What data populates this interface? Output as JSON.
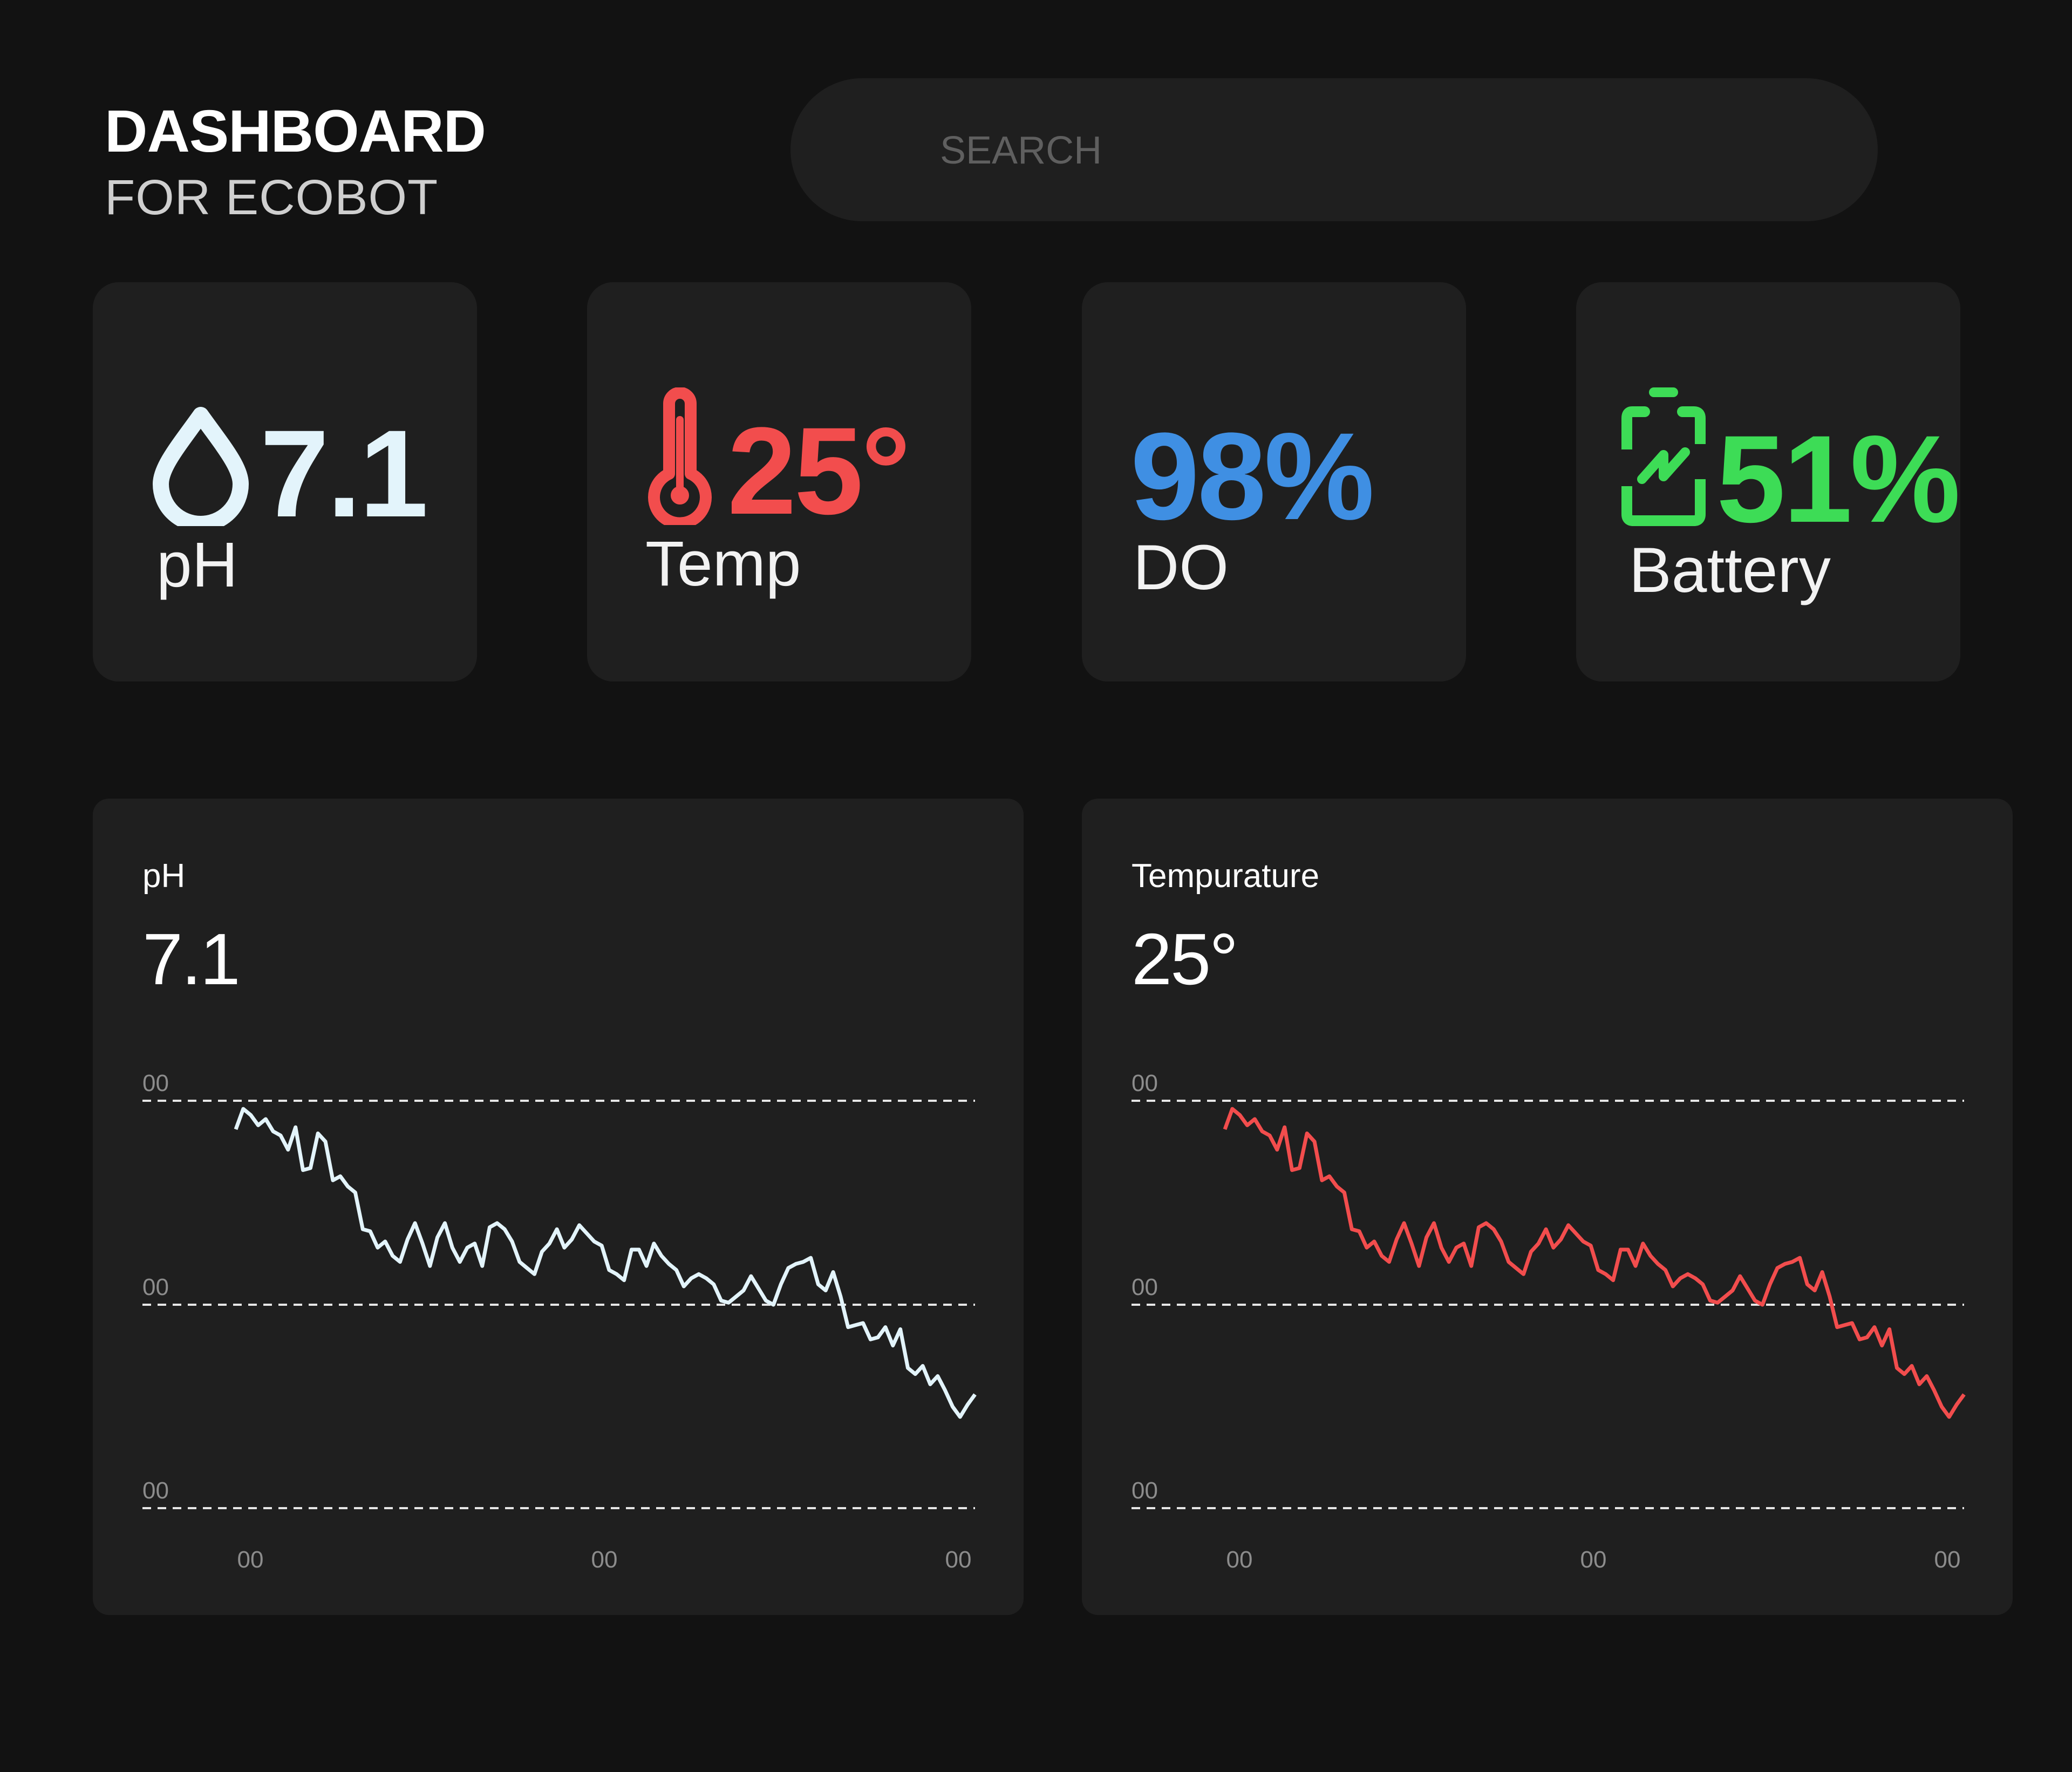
{
  "header": {
    "title": "DASHBOARD",
    "subtitle": "FOR ECOBOT"
  },
  "search": {
    "placeholder": "SEARCH",
    "value": ""
  },
  "cards": [
    {
      "icon": "water-drop-icon",
      "value": "7.1",
      "label": "pH",
      "color": "#e3f4fb"
    },
    {
      "icon": "thermometer-icon",
      "value": "25°",
      "label": "Temp",
      "color": "#f24d4d"
    },
    {
      "icon": "",
      "value": "98%",
      "label": "DO",
      "color": "#3f8fe3"
    },
    {
      "icon": "battery-charging-icon",
      "value": "51%",
      "label": "Battery",
      "color": "#3ddc56"
    }
  ],
  "panels": [
    {
      "title": "pH",
      "value": "7.1"
    },
    {
      "title": "Tempurature",
      "value": "25°"
    }
  ],
  "chart_data": [
    {
      "type": "line",
      "title": "pH",
      "color": "#e3f4fb",
      "y_tick_labels": [
        "00",
        "00",
        "00"
      ],
      "x_tick_labels": [
        "00",
        "00",
        "00"
      ],
      "grid": "dashed horizontal",
      "ylim": [
        0,
        100
      ],
      "series": [
        {
          "values": [
            86,
            96,
            93,
            88,
            91,
            85,
            83,
            76,
            87,
            66,
            67,
            84,
            80,
            61,
            63,
            58,
            55,
            37,
            36,
            28,
            31,
            24,
            21,
            32,
            40,
            30,
            19,
            33,
            40,
            28,
            21,
            28,
            30,
            19,
            38,
            40,
            37,
            31,
            21,
            18,
            15,
            26,
            30,
            37,
            28,
            32,
            39,
            35,
            31,
            29,
            17,
            15,
            12,
            27,
            27,
            19,
            30,
            24,
            20,
            17,
            9,
            13,
            15,
            13,
            10,
            2,
            1,
            4,
            7,
            14,
            8,
            2,
            0,
            10,
            18,
            20,
            21,
            23,
            10,
            7,
            16,
            4,
            -11,
            -10,
            -9,
            -17,
            -16,
            -11,
            -20,
            -12,
            -31,
            -34,
            -30,
            -39,
            -35,
            -42,
            -50,
            -55,
            -49,
            -44
          ]
        }
      ]
    },
    {
      "type": "line",
      "title": "Tempurature",
      "color": "#f24d4d",
      "y_tick_labels": [
        "00",
        "00",
        "00"
      ],
      "x_tick_labels": [
        "00",
        "00",
        "00"
      ],
      "grid": "dashed horizontal",
      "ylim": [
        0,
        100
      ],
      "series": [
        {
          "values": [
            86,
            96,
            93,
            88,
            91,
            85,
            83,
            76,
            87,
            66,
            67,
            84,
            80,
            61,
            63,
            58,
            55,
            37,
            36,
            28,
            31,
            24,
            21,
            32,
            40,
            30,
            19,
            33,
            40,
            28,
            21,
            28,
            30,
            19,
            38,
            40,
            37,
            31,
            21,
            18,
            15,
            26,
            30,
            37,
            28,
            32,
            39,
            35,
            31,
            29,
            17,
            15,
            12,
            27,
            27,
            19,
            30,
            24,
            20,
            17,
            9,
            13,
            15,
            13,
            10,
            2,
            1,
            4,
            7,
            14,
            8,
            2,
            0,
            10,
            18,
            20,
            21,
            23,
            10,
            7,
            16,
            4,
            -11,
            -10,
            -9,
            -17,
            -16,
            -11,
            -20,
            -12,
            -31,
            -34,
            -30,
            -39,
            -35,
            -42,
            -50,
            -55,
            -49,
            -44
          ]
        }
      ]
    }
  ]
}
